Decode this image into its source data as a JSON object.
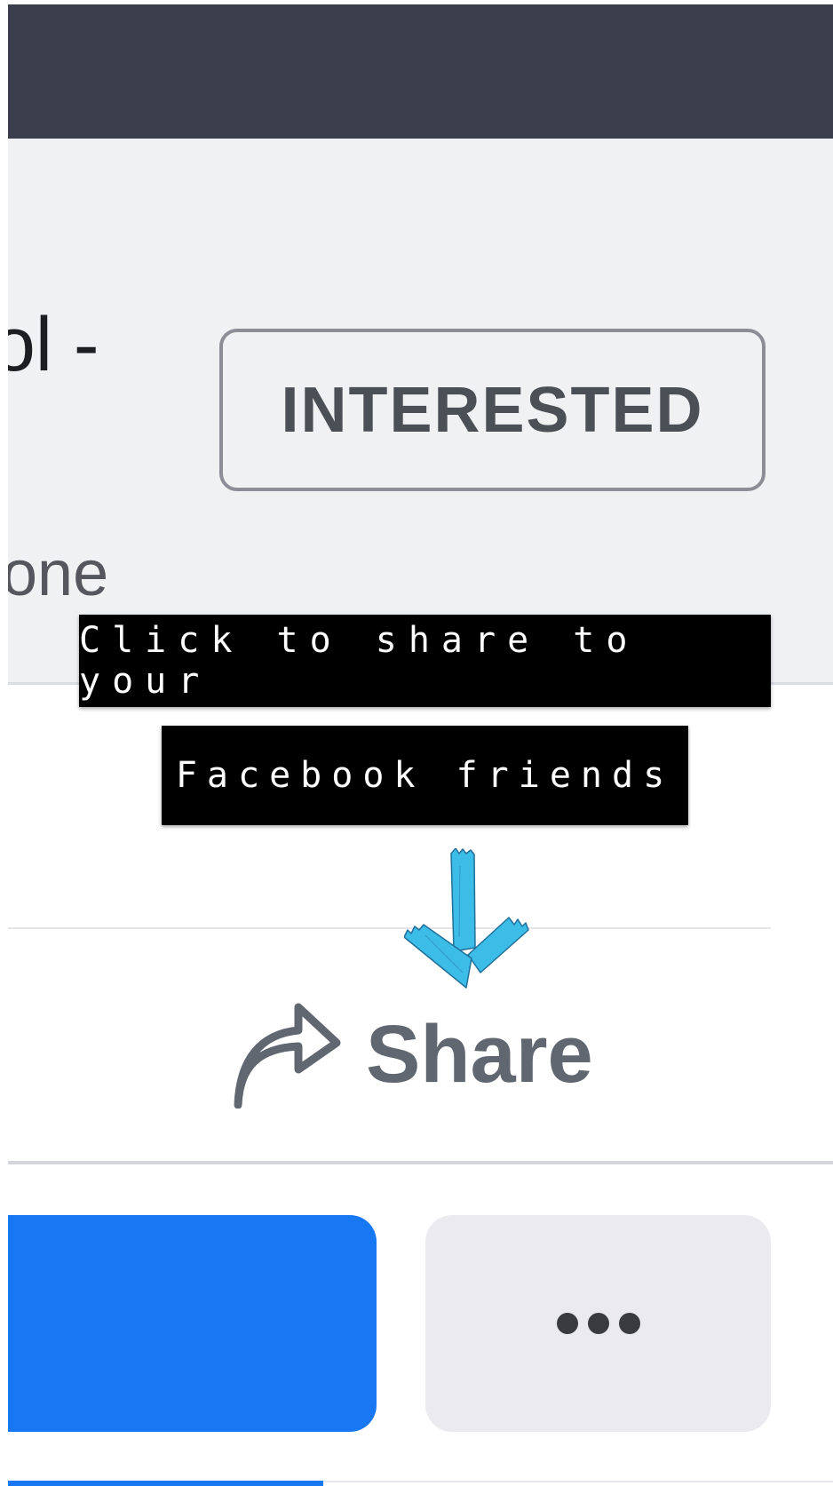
{
  "event": {
    "title_fragment": "ol -",
    "subtitle_fragment": "one",
    "interested_label": "INTERESTED"
  },
  "caption": {
    "line1": "Click to share to your",
    "line2": "Facebook friends"
  },
  "actions": {
    "share_label": "Share",
    "share_icon": "share-arrow-icon",
    "more_icon": "ellipsis-icon"
  },
  "annotation": {
    "arrow_icon": "hand-drawn-down-arrow",
    "arrow_color": "#3cbde8"
  },
  "colors": {
    "top_bar": "#3b3e4c",
    "header_bg": "#f0f1f3",
    "primary_button": "#1877f2",
    "more_button_bg": "#ebebef",
    "share_text": "#606770"
  }
}
